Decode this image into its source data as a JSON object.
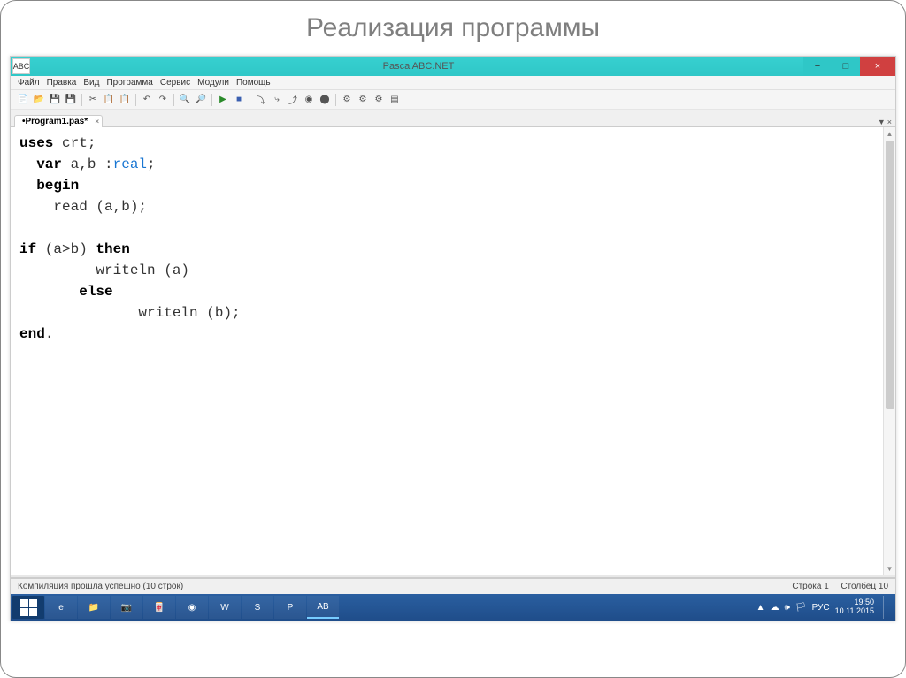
{
  "slide_title": "Реализация программы",
  "titlebar": {
    "icon_label": "ABC",
    "title": "PascalABC.NET",
    "min_label": "−",
    "max_label": "□",
    "close_label": "×"
  },
  "menubar": [
    "Файл",
    "Правка",
    "Вид",
    "Программа",
    "Сервис",
    "Модули",
    "Помощь"
  ],
  "toolbar_icons": [
    "new",
    "open",
    "save",
    "saveall",
    "|",
    "cut",
    "copy",
    "paste",
    "|",
    "undo",
    "redo",
    "|",
    "find",
    "findnext",
    "|",
    "run",
    "stop",
    "|",
    "stepover",
    "stepin",
    "stepout",
    "tracepoint",
    "breakpoint",
    "|",
    "compile",
    "build",
    "rebuild",
    "output"
  ],
  "tab": {
    "label": "•Program1.pas*",
    "close": "×"
  },
  "tab_dropdown": {
    "down": "▼",
    "close": "×"
  },
  "code_html": "<span class='kw'>uses</span> crt;\n  <span class='kw'>var</span> a,b :<span class='ty'>real</span>;\n  <span class='kw'>begin</span>\n    read (a,b);\n\n<span class='kw'>if</span> (a&gt;b) <span class='kw'>then</span>\n         writeln (a)\n       <span class='kw'>else</span>\n              writeln (b);\n<span class='kw'>end</span>.",
  "statusbar": {
    "left": "Компиляция прошла успешно (10 строк)",
    "line": "Строка  1",
    "col": "Столбец  10"
  },
  "taskbar": {
    "apps": [
      "ie",
      "explorer",
      "camera",
      "mahjong",
      "chrome",
      "word",
      "skype",
      "powerpoint",
      "pascalabc"
    ],
    "tray": [
      "▲",
      "☁",
      "🕪",
      "🏳"
    ],
    "lang": "РУС",
    "time": "19:50",
    "date": "10.11.2015"
  },
  "icons": {
    "new": "📄",
    "open": "📂",
    "save": "💾",
    "saveall": "💾",
    "cut": "✂",
    "copy": "📋",
    "paste": "📋",
    "undo": "↶",
    "redo": "↷",
    "find": "🔍",
    "findnext": "🔎",
    "run": "▶",
    "stop": "■",
    "stepover": "⤵",
    "stepin": "⤷",
    "stepout": "⤴",
    "tracepoint": "◉",
    "breakpoint": "⬤",
    "compile": "⚙",
    "build": "⚙",
    "rebuild": "⚙",
    "output": "▤"
  }
}
